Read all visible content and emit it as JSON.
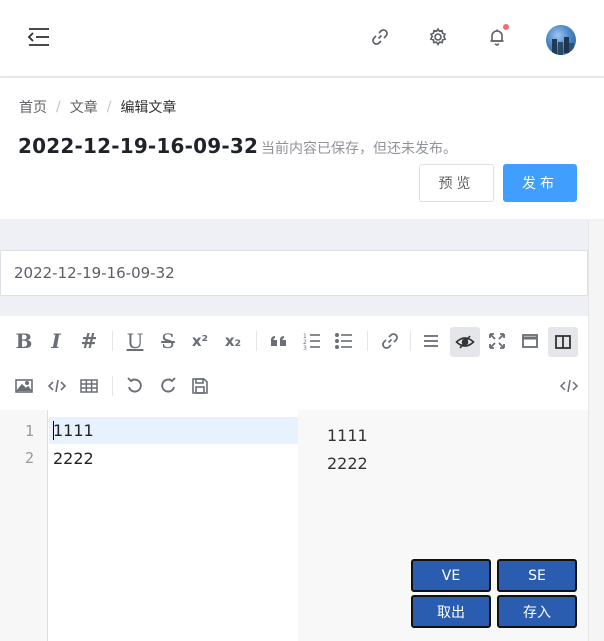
{
  "header": {
    "icons": [
      "menu-fold-icon",
      "link-icon",
      "gear-icon",
      "bell-icon",
      "avatar"
    ],
    "notification_dot_color": "#f56c6c"
  },
  "breadcrumb": {
    "items": [
      "首页",
      "文章",
      "编辑文章"
    ],
    "separator": "/"
  },
  "page": {
    "title": "2022-12-19-16-09-32",
    "status": "当前内容已保存，但还未发布。",
    "preview_label": "预览",
    "publish_label": "发布"
  },
  "form": {
    "title_value": "2022-12-19-16-09-32"
  },
  "toolbar": {
    "bold": "B",
    "italic": "I",
    "header": "#",
    "underline": "U",
    "strike": "S",
    "superscript": "x²",
    "subscript": "x₂"
  },
  "editor": {
    "line_numbers": [
      "1",
      "2"
    ],
    "lines": [
      "1111",
      "2222"
    ],
    "preview_lines": [
      "1111",
      "2222"
    ]
  },
  "floating": {
    "ve_label": "VE",
    "se_label": "SE",
    "take_label": "取出",
    "store_label": "存入"
  },
  "colors": {
    "primary": "#409eff",
    "float_button": "#2a5db0"
  }
}
